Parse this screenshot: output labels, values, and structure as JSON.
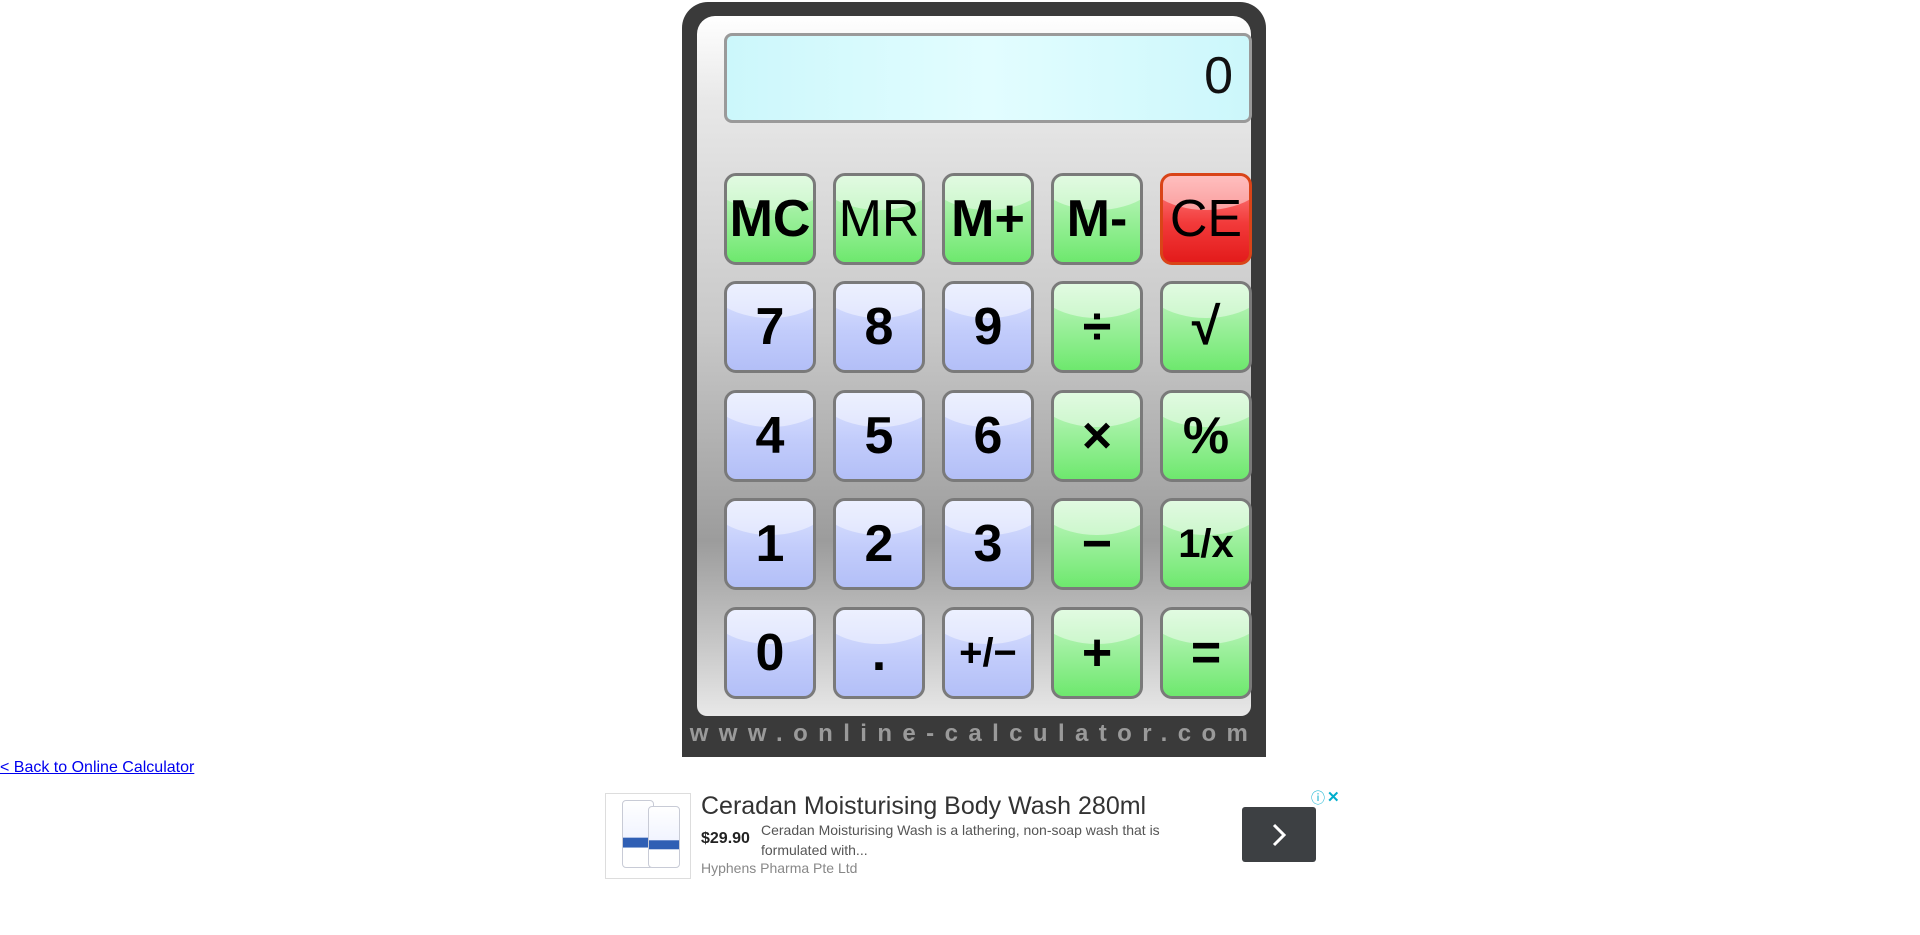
{
  "calculator": {
    "display": "0",
    "brand": "www.online-calculator.com",
    "colors": {
      "memory_keys": "#7fe87f",
      "clear_key": "#f23a3a",
      "number_keys": "#c2ccfb",
      "operator_keys": "#7fe87f",
      "display_bg": "#dcfcff",
      "body": "#3a3a3a"
    },
    "keys": {
      "mc": "MC",
      "mr": "MR",
      "mplus": "M+",
      "mminus": "M-",
      "ce": "CE",
      "n7": "7",
      "n8": "8",
      "n9": "9",
      "divide": "÷",
      "sqrt": "√",
      "n4": "4",
      "n5": "5",
      "n6": "6",
      "multiply": "×",
      "percent": "%",
      "n1": "1",
      "n2": "2",
      "n3": "3",
      "minus": "−",
      "reciprocal": "1/x",
      "n0": "0",
      "decimal": ".",
      "negate": "+/−",
      "plus": "+",
      "equals": "="
    }
  },
  "back_link": "< Back to Online Calculator",
  "ad": {
    "title": "Ceradan Moisturising Body Wash 280ml",
    "price": "$29.90",
    "description": "Ceradan Moisturising Wash is a lathering, non-soap wash that is formulated with...",
    "seller": "Hyphens Pharma Pte Ltd",
    "info_icon": "info-icon",
    "close_icon": "close-icon",
    "cta_icon": "chevron-right-icon"
  }
}
